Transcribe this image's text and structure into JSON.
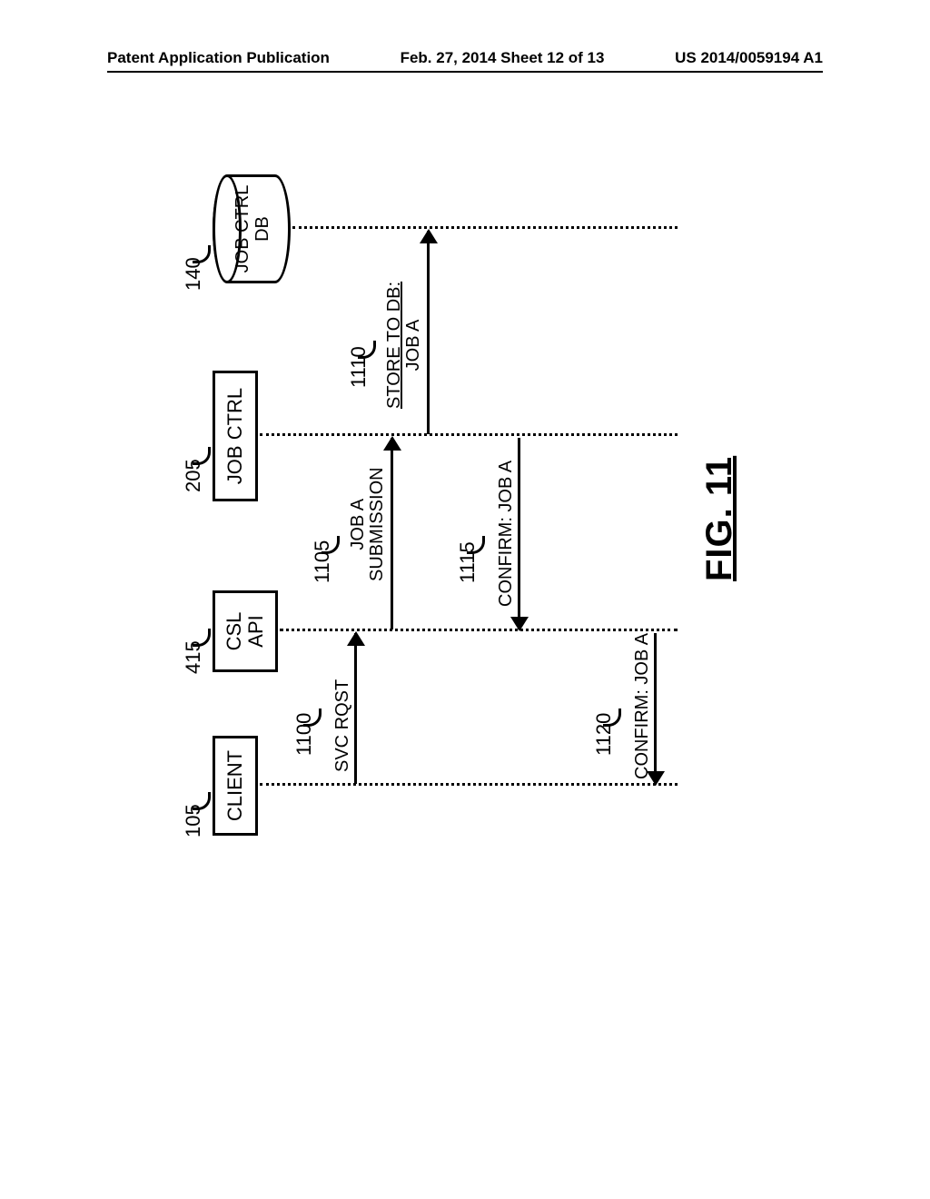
{
  "header": {
    "left": "Patent Application Publication",
    "center": "Feb. 27, 2014  Sheet 12 of 13",
    "right": "US 2014/0059194 A1"
  },
  "participants": {
    "client": {
      "ref": "105",
      "label": "CLIENT"
    },
    "csl_api": {
      "ref": "415",
      "label1": "CSL",
      "label2": "API"
    },
    "job_ctrl": {
      "ref": "205",
      "label": "JOB CTRL"
    },
    "db": {
      "ref": "140",
      "label1": "JOB CTRL",
      "label2": "DB"
    }
  },
  "messages": {
    "m1100": {
      "ref": "1100",
      "text": "SVC RQST"
    },
    "m1105": {
      "ref": "1105",
      "text1": "JOB A",
      "text2": "SUBMISSION"
    },
    "m1110": {
      "ref": "1110",
      "text1": "STORE TO DB:",
      "text2": "JOB A"
    },
    "m1115": {
      "ref": "1115",
      "text": "CONFIRM: JOB A"
    },
    "m1120": {
      "ref": "1120",
      "text": "CONFIRM: JOB A"
    }
  },
  "figure_label": "FIG. 11"
}
